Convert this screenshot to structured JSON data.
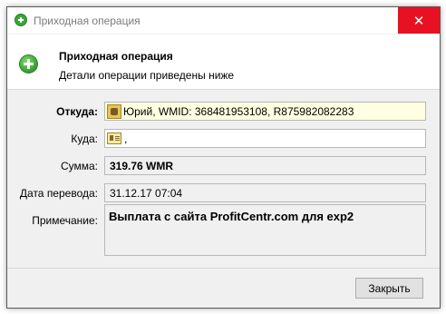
{
  "window": {
    "title": "Приходная операция",
    "close_glyph": "✕"
  },
  "header": {
    "title": "Приходная операция",
    "subtitle": "Детали операции приведены ниже",
    "icon": "plus-circle-icon"
  },
  "form": {
    "from": {
      "label": "Откуда:",
      "value": "Юрий, WMID: 368481953108, R875982082283",
      "icon": "wallet-icon"
    },
    "to": {
      "label": "Куда:",
      "value": ",",
      "icon": "contact-card-icon"
    },
    "amount": {
      "label": "Сумма:",
      "value": "319.76 WMR"
    },
    "date": {
      "label": "Дата перевода:",
      "value": "31.12.17 07:04"
    },
    "note": {
      "label": "Примечание:",
      "value": "Выплата с сайта ProfitCentr.com для exp2"
    }
  },
  "footer": {
    "close_button": "Закрыть"
  },
  "colors": {
    "close_bg": "#e81123",
    "from_field_bg": "#ffffe1",
    "accent_green": "#3aa63a"
  }
}
